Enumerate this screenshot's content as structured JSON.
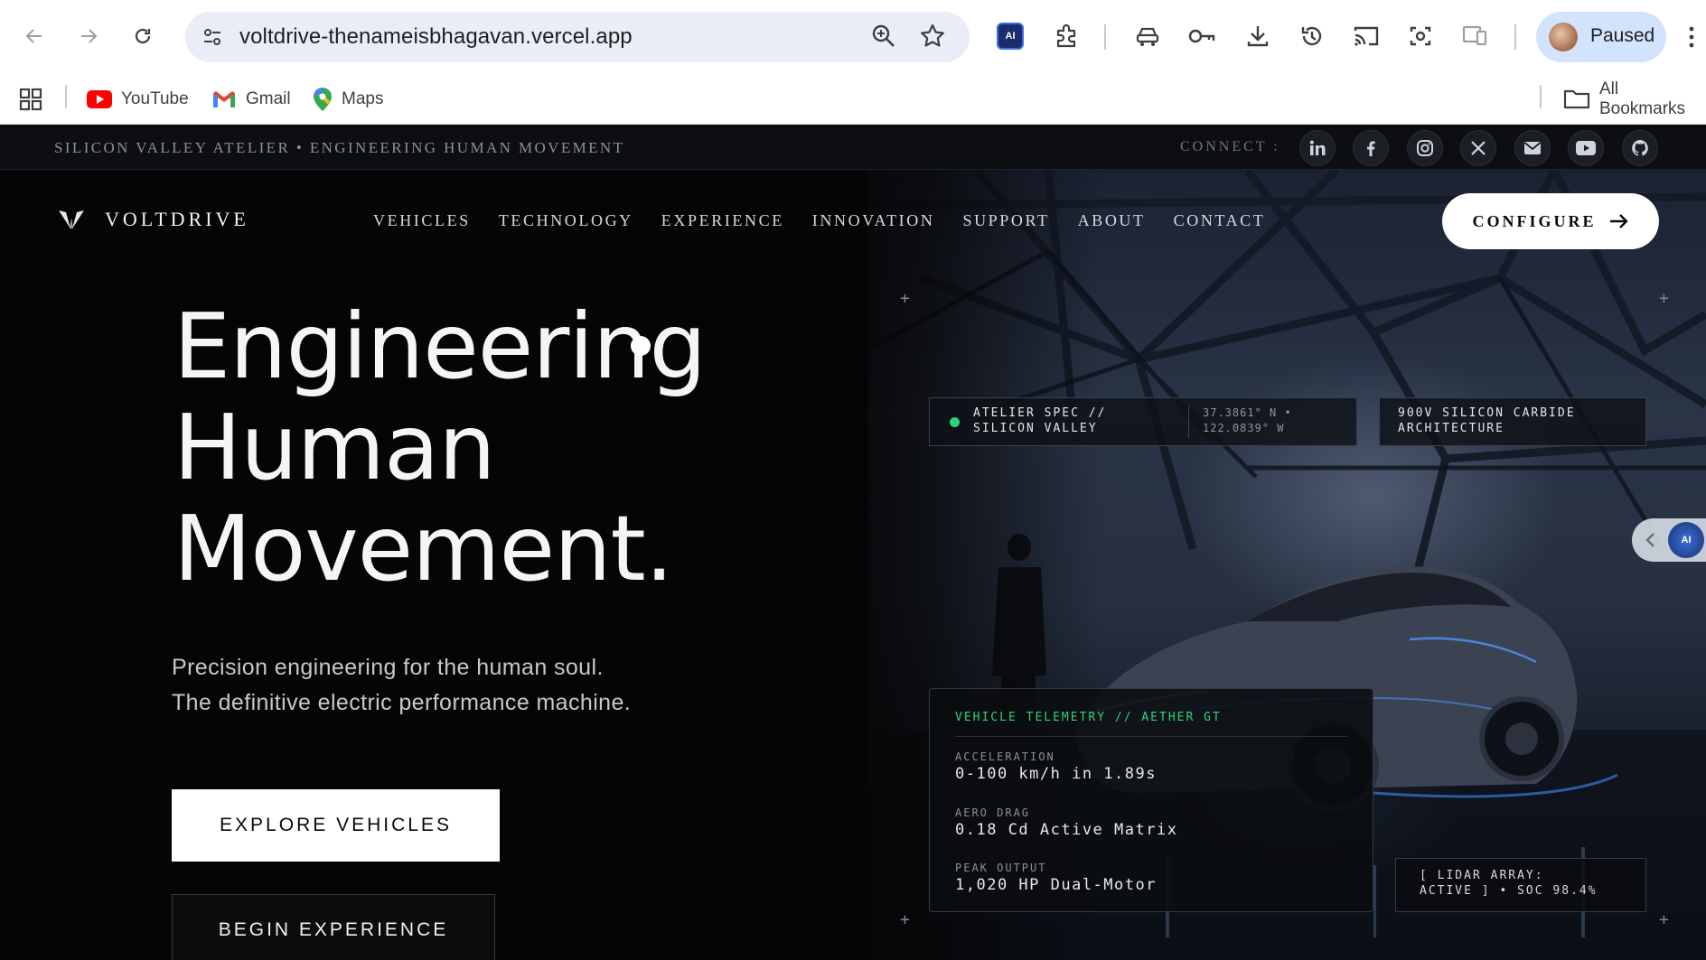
{
  "browser": {
    "url": "voltdrive-thenameisbhagavan.vercel.app",
    "profile_label": "Paused",
    "bookmarks": [
      {
        "label": "YouTube",
        "icon": "youtube-icon"
      },
      {
        "label": "Gmail",
        "icon": "gmail-icon"
      },
      {
        "label": "Maps",
        "icon": "maps-icon"
      }
    ],
    "all_bookmarks_label": "All Bookmarks"
  },
  "topbar": {
    "tagline": "SILICON VALLEY ATELIER • ENGINEERING HUMAN MOVEMENT",
    "connect_label": "CONNECT :",
    "socials": [
      "linkedin-icon",
      "facebook-icon",
      "instagram-icon",
      "x-icon",
      "mail-icon",
      "youtube-icon",
      "github-icon"
    ]
  },
  "nav": {
    "brand": "VOLTDRIVE",
    "links": [
      "VEHICLES",
      "TECHNOLOGY",
      "EXPERIENCE",
      "INNOVATION",
      "SUPPORT",
      "ABOUT",
      "CONTACT"
    ],
    "configure_label": "CONFIGURE"
  },
  "hero": {
    "headline": [
      "Engineering",
      "Human",
      "Movement."
    ],
    "sub_line1": "Precision engineering for the human soul.",
    "sub_line2": "The definitive electric performance machine.",
    "cta_primary": "EXPLORE VEHICLES",
    "cta_secondary": "BEGIN EXPERIENCE"
  },
  "cards": {
    "spec_line1": "ATELIER SPEC //",
    "spec_line2": "SILICON VALLEY",
    "coords_line1": "37.3861° N •",
    "coords_line2": "122.0839° W",
    "arch_line1": "900V SILICON CARBIDE",
    "arch_line2": "ARCHITECTURE",
    "side_tab_label": "AI",
    "telemetry": {
      "header": "VEHICLE TELEMETRY // AETHER GT",
      "items": [
        {
          "label": "ACCELERATION",
          "value": "0-100 km/h in 1.89s"
        },
        {
          "label": "AERO DRAG",
          "value": "0.18 Cd Active Matrix"
        },
        {
          "label": "PEAK OUTPUT",
          "value": "1,020 HP Dual-Motor"
        }
      ]
    },
    "lidar_line1": "[ LIDAR ARRAY:",
    "lidar_line2": "ACTIVE ] • SOC 98.4%"
  },
  "colors": {
    "accent_green": "#2ed27a",
    "background": "#050505",
    "chrome_omnibox": "#e8edf7",
    "profile_chip": "#d3e3fd"
  }
}
